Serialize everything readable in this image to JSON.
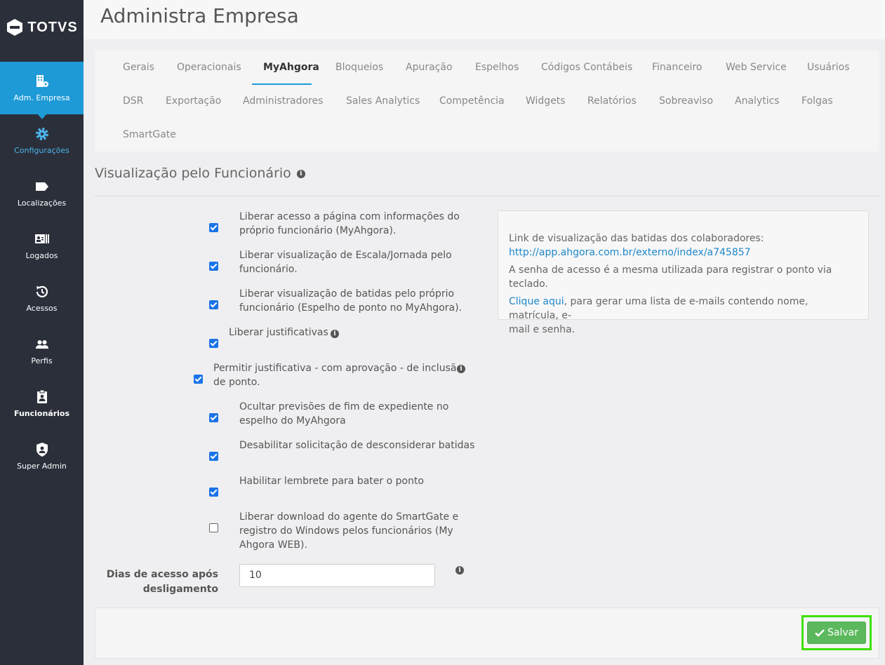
{
  "brand": {
    "logo_text": "TOTVS"
  },
  "sidebar": {
    "items": [
      {
        "label": "Adm. Empresa",
        "icon": "building-gear-icon"
      },
      {
        "label": "Configurações",
        "icon": "gear-icon"
      },
      {
        "label": "Localizações",
        "icon": "tag-icon"
      },
      {
        "label": "Logados",
        "icon": "id-card-icon"
      },
      {
        "label": "Acessos",
        "icon": "history-icon"
      },
      {
        "label": "Perfis",
        "icon": "users-icon"
      },
      {
        "label": "Funcionários",
        "icon": "badge-icon"
      },
      {
        "label": "Super Admin",
        "icon": "shield-user-icon"
      }
    ]
  },
  "header": {
    "title": "Administra Empresa"
  },
  "tabs": [
    "Gerais",
    "Operacionais",
    "MyAhgora",
    "Bloqueios",
    "Apuração",
    "Espelhos",
    "Códigos Contábeis",
    "Financeiro",
    "Web Service",
    "Usuários",
    "DSR",
    "Exportação",
    "Administradores",
    "Sales Analytics",
    "Competência",
    "Widgets",
    "Relatórios",
    "Sobreaviso",
    "Analytics",
    "Folgas",
    "SmartGate"
  ],
  "active_tab": "MyAhgora",
  "section": {
    "title": "Visualização pelo Funcionário"
  },
  "options": [
    {
      "line1": "Liberar acesso a página com informações do",
      "line2": "próprio funcionário (MyAhgora).",
      "checked": true
    },
    {
      "line1": "Liberar visualização de Escala/Jornada pelo",
      "line2": "funcionário.",
      "checked": true
    },
    {
      "line1": "Liberar visualização de batidas pelo próprio",
      "line2": "funcionário (Espelho de ponto no MyAhgora).",
      "checked": true
    },
    {
      "line1": "Liberar justificativas",
      "checked": true
    },
    {
      "line1": "Permitir justificativa - com aprovação - de inclusão",
      "line2": "de ponto.",
      "checked": true
    },
    {
      "line1": "Ocultar previsões de fim de expediente no",
      "line2": "espelho do MyAhgora",
      "checked": true
    },
    {
      "line1": "Desabilitar solicitação de desconsiderar batidas",
      "checked": true
    },
    {
      "line1": "Habilitar lembrete para bater o ponto",
      "checked": true
    },
    {
      "line1": "Liberar download do agente do SmartGate e",
      "line2": "registro do Windows pelos funcionários (My",
      "line3": "Ahgora WEB).",
      "checked": false
    }
  ],
  "info_panel": {
    "intro": "Link de visualização das batidas dos colaboradores:",
    "url": "http://app.ahgora.com.br/externo/index/a745857",
    "password_note": "A senha de acesso é a mesma utilizada para registrar o ponto via teclado.",
    "click_link": "Clique aqui",
    "click_rest": ", para gerar uma lista de e-mails contendo nome, matrícula, e-",
    "click_rest2": "mail e senha."
  },
  "days_field": {
    "label_line1": "Dias de acesso após",
    "label_line2": "desligamento",
    "value": "10"
  },
  "footer": {
    "save_label": "Salvar"
  },
  "colors": {
    "sidebar_bg": "#2b2f3a",
    "accent": "#1e9ad6",
    "save_green": "#5cb85c",
    "highlight": "#3fe000"
  }
}
